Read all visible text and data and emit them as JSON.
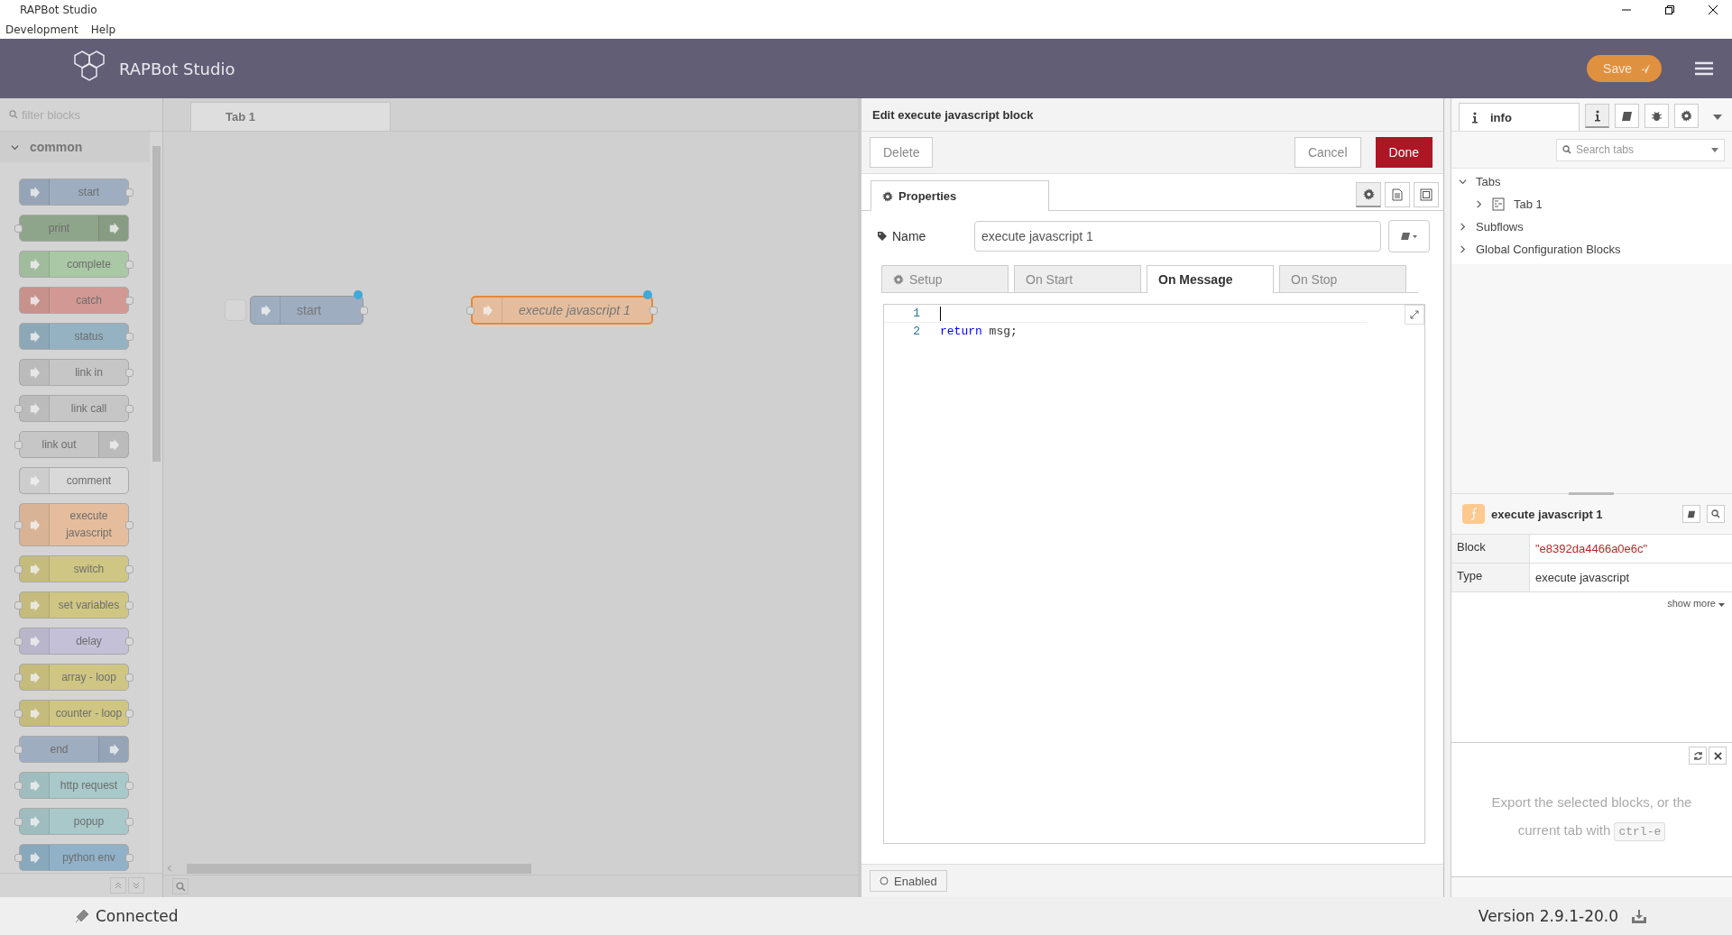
{
  "window": {
    "title": "RAPBot Studio"
  },
  "menu": [
    "Development",
    "Help"
  ],
  "header": {
    "title": "RAPBot Studio",
    "save": "Save"
  },
  "palette": {
    "filter_placeholder": "filter blocks",
    "category": {
      "label": "common",
      "expanded": true
    },
    "blocks": [
      {
        "label": "start",
        "color": "#9eadc0",
        "input": false,
        "output": true,
        "icon_right": false
      },
      {
        "label": "print",
        "color": "#8fa58b",
        "input": true,
        "output": false,
        "icon_right": true
      },
      {
        "label": "complete",
        "color": "#aac7a6",
        "input": false,
        "output": true,
        "icon_right": false
      },
      {
        "label": "catch",
        "color": "#d29994",
        "input": false,
        "output": true,
        "icon_right": false
      },
      {
        "label": "status",
        "color": "#94b2c1",
        "input": false,
        "output": true,
        "icon_right": false
      },
      {
        "label": "link in",
        "color": "#c6c6c6",
        "input": false,
        "output": true,
        "icon_right": false
      },
      {
        "label": "link call",
        "color": "#c6c6c6",
        "input": true,
        "output": true,
        "icon_right": false
      },
      {
        "label": "link out",
        "color": "#c6c6c6",
        "input": true,
        "output": false,
        "icon_right": true
      },
      {
        "label": "comment",
        "color": "#d9d9d9",
        "input": false,
        "output": false,
        "icon_right": false
      },
      {
        "label": "execute javascript",
        "color": "#e5bd9d",
        "input": true,
        "output": true,
        "icon_right": false
      },
      {
        "label": "switch",
        "color": "#cfc683",
        "input": true,
        "output": true,
        "icon_right": false
      },
      {
        "label": "set variables",
        "color": "#cfc683",
        "input": true,
        "output": true,
        "icon_right": false
      },
      {
        "label": "delay",
        "color": "#c3c0d7",
        "input": true,
        "output": true,
        "icon_right": false
      },
      {
        "label": "array - loop",
        "color": "#cfc683",
        "input": true,
        "output": true,
        "icon_right": false
      },
      {
        "label": "counter - loop",
        "color": "#cfc683",
        "input": true,
        "output": true,
        "icon_right": false
      },
      {
        "label": "end",
        "color": "#9eadc0",
        "input": true,
        "output": false,
        "icon_right": true
      },
      {
        "label": "http request",
        "color": "#a8c8ca",
        "input": true,
        "output": true,
        "icon_right": false
      },
      {
        "label": "popup",
        "color": "#a8c8ca",
        "input": true,
        "output": true,
        "icon_right": false
      },
      {
        "label": "python env",
        "color": "#90b1c7",
        "input": true,
        "output": true,
        "icon_right": false
      }
    ]
  },
  "workspace": {
    "tabs": [
      {
        "label": "Tab 1",
        "selected": true
      }
    ],
    "nodes": [
      {
        "label": "start",
        "color": "#9eadc0",
        "input": false,
        "output": true,
        "button": true,
        "changed": true,
        "selected": false,
        "unnamed": false
      },
      {
        "label": "execute javascript 1",
        "color": "#e5bd9d",
        "input": true,
        "output": true,
        "button": false,
        "changed": true,
        "selected": true,
        "unnamed": true
      }
    ]
  },
  "editor": {
    "title": "Edit execute javascript block",
    "delete": "Delete",
    "cancel": "Cancel",
    "done": "Done",
    "tab": {
      "label": "Properties",
      "selected": true
    },
    "view_buttons": [
      {
        "selected": true
      },
      {
        "selected": false
      },
      {
        "selected": false
      }
    ],
    "name_label": "Name",
    "name_value": "execute javascript 1",
    "code_tabs": [
      {
        "label": "Setup",
        "selected": false,
        "has_icon": true
      },
      {
        "label": "On Start",
        "selected": false,
        "has_icon": false
      },
      {
        "label": "On Message",
        "selected": true,
        "has_icon": false
      },
      {
        "label": "On Stop",
        "selected": false,
        "has_icon": false
      }
    ],
    "code_lines": [
      {
        "number": "1",
        "active": true
      },
      {
        "number": "2",
        "active": false,
        "tokens": [
          {
            "text": "return",
            "kind": "keyword"
          },
          {
            "text": " msg;",
            "kind": "plain"
          }
        ]
      }
    ],
    "enabled": "Enabled"
  },
  "sidebar": {
    "tab": {
      "label": "info",
      "selected": true
    },
    "tool_buttons": [
      {
        "selected": true
      },
      {
        "selected": false
      },
      {
        "selected": false
      },
      {
        "selected": false
      }
    ],
    "search_placeholder": "Search tabs",
    "tree": [
      {
        "label": "Tabs",
        "expanded": true,
        "children": [
          {
            "label": "Tab 1",
            "expanded": false
          }
        ]
      },
      {
        "label": "Subflows",
        "expanded": false
      },
      {
        "label": "Global Configuration Blocks",
        "expanded": false
      }
    ],
    "selected_block": {
      "label": "execute javascript 1",
      "color": "#fdc98f"
    },
    "properties": [
      {
        "name": "Block",
        "value": "\"e8392da4466a0e6c\"",
        "kind": "string"
      },
      {
        "name": "Type",
        "value": "execute javascript",
        "kind": "plain"
      }
    ],
    "show_more": "show more",
    "help": {
      "text": "Export the selected blocks, or the current tab with",
      "key": "ctrl-e"
    }
  },
  "status_bar": {
    "connection": "Connected",
    "version": "Version 2.9.1-20.0"
  }
}
